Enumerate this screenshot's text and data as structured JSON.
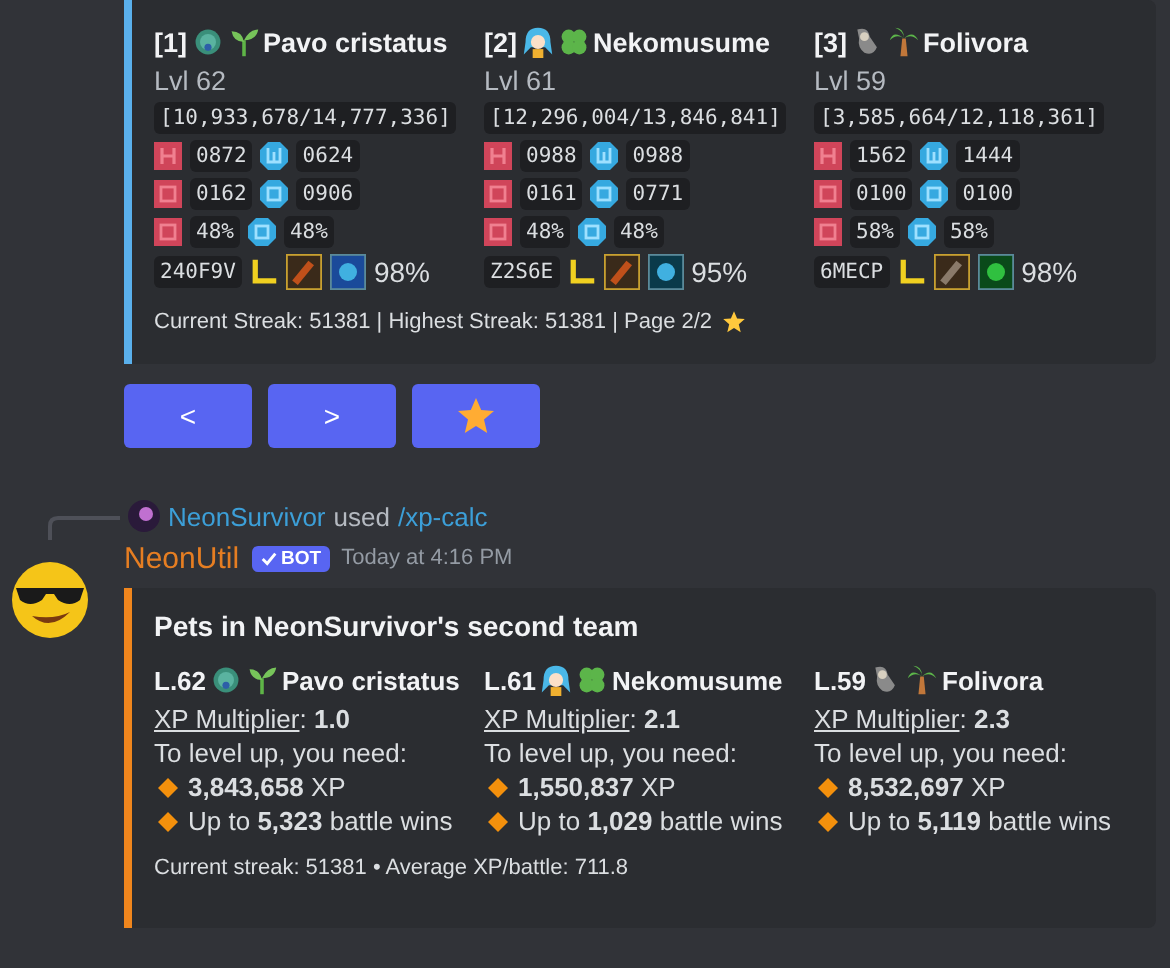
{
  "top_embed": {
    "pets": [
      {
        "index": "[1]",
        "name": "Pavo cristatus",
        "level": "Lvl 62",
        "xp": "[10,933,678/14,777,336]",
        "stats": [
          [
            "0872",
            "0624"
          ],
          [
            "0162",
            "0906"
          ],
          [
            "48%",
            "48%"
          ]
        ],
        "code": "240F9V",
        "percent": "98%"
      },
      {
        "index": "[2]",
        "name": "Nekomusume",
        "level": "Lvl 61",
        "xp": "[12,296,004/13,846,841]",
        "stats": [
          [
            "0988",
            "0988"
          ],
          [
            "0161",
            "0771"
          ],
          [
            "48%",
            "48%"
          ]
        ],
        "code": "Z2S6E",
        "percent": "95%"
      },
      {
        "index": "[3]",
        "name": "Folivora",
        "level": "Lvl 59",
        "xp": "[3,585,664/12,118,361]",
        "stats": [
          [
            "1562",
            "1444"
          ],
          [
            "0100",
            "0100"
          ],
          [
            "58%",
            "58%"
          ]
        ],
        "code": "6MECP",
        "percent": "98%"
      }
    ],
    "footer": "Current Streak: 51381 | Highest Streak: 51381 | Page 2/2"
  },
  "buttons": [
    {
      "kind": "text",
      "label": "<"
    },
    {
      "kind": "text",
      "label": ">"
    },
    {
      "kind": "star"
    }
  ],
  "reply": {
    "user": "NeonSurvivor",
    "verb": "used",
    "command": "/xp-calc"
  },
  "message": {
    "author": "NeonUtil",
    "badge": "BOT",
    "timestamp": "Today at 4:16 PM"
  },
  "embed": {
    "title": "Pets in NeonSurvivor's second team",
    "pets": [
      {
        "level": "L.62",
        "name": "Pavo cristatus",
        "multiplier_label": "XP Multiplier",
        "multiplier": ": **1.0**",
        "need": "To level up, you need:",
        "xp": "**3,843,658** XP",
        "wins": "Up to **5,323** battle wins"
      },
      {
        "level": "L.61",
        "name": "Nekomusume",
        "multiplier_label": "XP Multiplier",
        "multiplier": ": **2.1**",
        "need": "To level up, you need:",
        "xp": "**1,550,837** XP",
        "wins": "Up to **1,029** battle wins"
      },
      {
        "level": "L.59",
        "name": "Folivora",
        "multiplier_label": "XP Multiplier",
        "multiplier": ": **2.3**",
        "need": "To level up, you need:",
        "xp": "**8,532,697** XP",
        "wins": "Up to **5,119** battle wins"
      }
    ],
    "footer": "Current streak: 51381 • Average XP/battle: 711.8"
  }
}
